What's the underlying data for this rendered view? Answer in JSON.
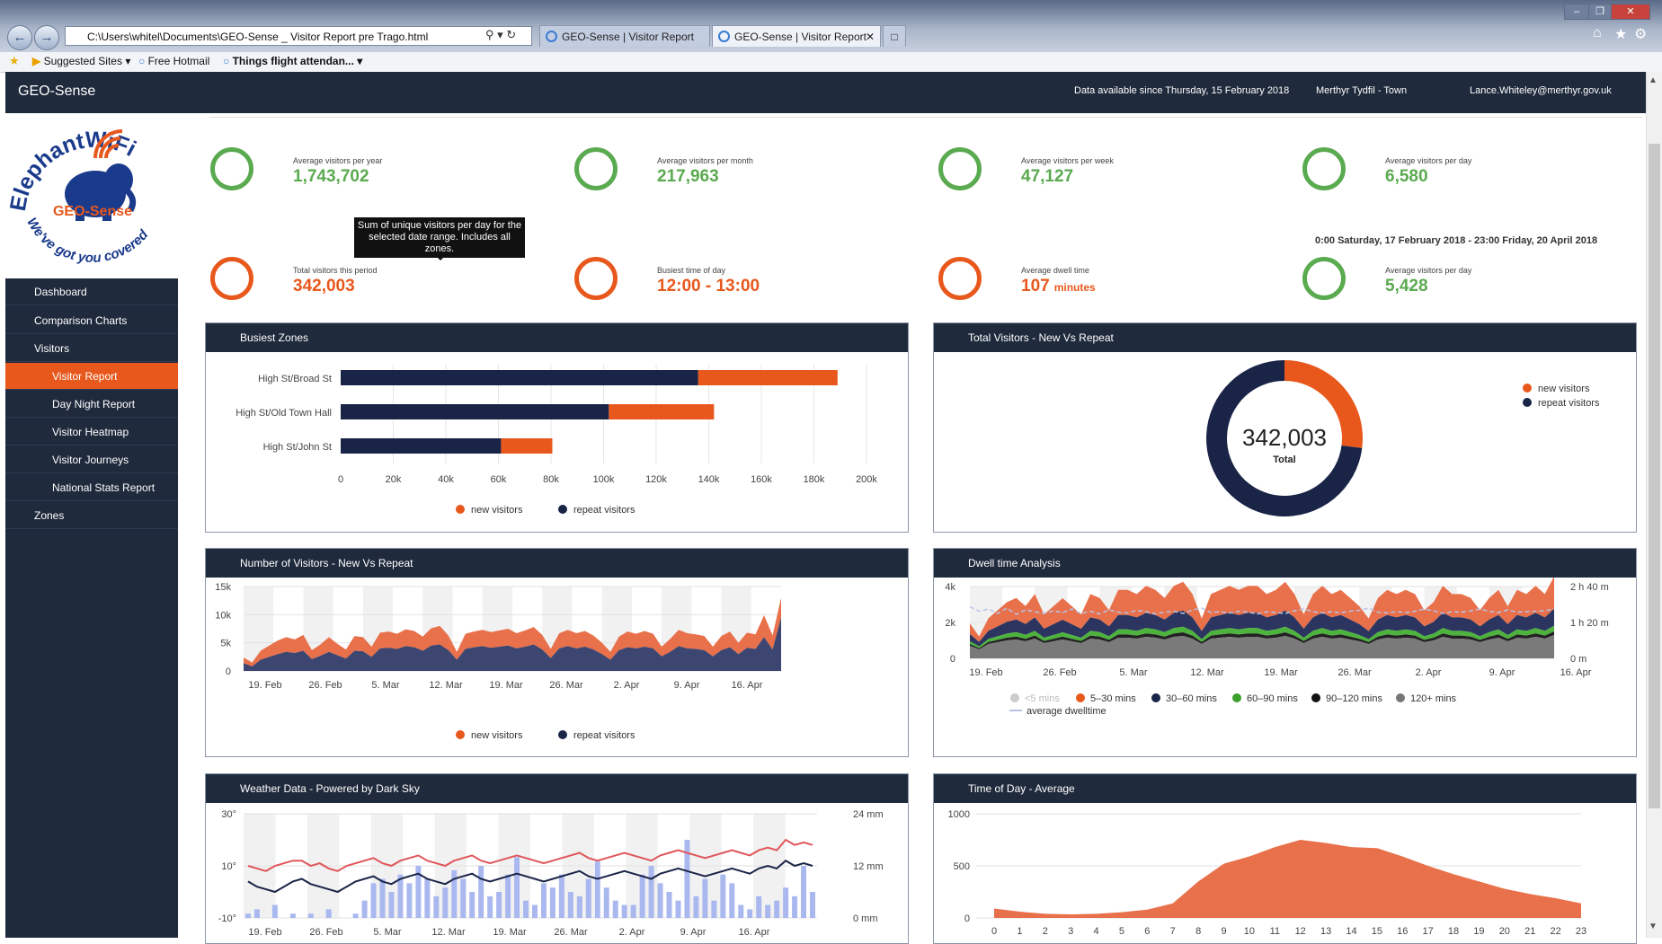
{
  "browser": {
    "address": "C:\\Users\\whitel\\Documents\\GEO-Sense _ Visitor Report pre Trago.html",
    "tabs": [
      "GEO-Sense | Visitor Report",
      "GEO-Sense | Visitor Report"
    ],
    "favorites": [
      "Suggested Sites",
      "Free Hotmail",
      "Things flight attendan..."
    ]
  },
  "header": {
    "app_title": "GEO-Sense",
    "data_since": "Data available since Thursday, 15 February 2018",
    "location": "Merthyr Tydfil - Town",
    "user": "Lance.Whiteley@merthyr.gov.uk"
  },
  "logo": {
    "brand": "ElephantWiFi",
    "product": "GEO-Sense",
    "tagline": "We've got you covered"
  },
  "sidebar": {
    "items": [
      {
        "label": "Dashboard",
        "level": 0
      },
      {
        "label": "Comparison Charts",
        "level": 0
      },
      {
        "label": "Visitors",
        "level": 0
      },
      {
        "label": "Visitor Report",
        "level": 1,
        "active": true
      },
      {
        "label": "Day Night Report",
        "level": 1
      },
      {
        "label": "Visitor Heatmap",
        "level": 1
      },
      {
        "label": "Visitor Journeys",
        "level": 1
      },
      {
        "label": "National Stats Report",
        "level": 1
      },
      {
        "label": "Zones",
        "level": 0
      }
    ]
  },
  "kpis_top": [
    {
      "label": "Average visitors per year",
      "value": "1,743,702"
    },
    {
      "label": "Average visitors per month",
      "value": "217,963"
    },
    {
      "label": "Average visitors per week",
      "value": "47,127"
    },
    {
      "label": "Average visitors per day",
      "value": "6,580"
    }
  ],
  "date_range": "0:00 Saturday, 17 February 2018 - 23:00 Friday, 20 April 2018",
  "tooltip": "Sum of unique visitors per day for the selected date range. Includes all zones.",
  "kpis_bottom": [
    {
      "label": "Total visitors this period",
      "value": "342,003",
      "unit": ""
    },
    {
      "label": "Busiest time of day",
      "value": "12:00 - 13:00",
      "unit": ""
    },
    {
      "label": "Average dwell time",
      "value": "107",
      "unit": "minutes"
    },
    {
      "label": "Average visitors per day",
      "value": "5,428",
      "unit": ""
    }
  ],
  "colors": {
    "new": "#e8581c",
    "repeat": "#1a2447",
    "green": "#5aaa4f",
    "navy": "#1f2a3c"
  },
  "panels": {
    "busiest_zones": "Busiest Zones",
    "new_vs_repeat": "Total Visitors - New Vs Repeat",
    "visitors_series": "Number of Visitors - New Vs Repeat",
    "dwell": "Dwell time Analysis",
    "weather": "Weather Data - Powered by Dark Sky",
    "time_of_day": "Time of Day - Average"
  },
  "chart_data": [
    {
      "type": "bar",
      "stacked": true,
      "orientation": "horizontal",
      "categories": [
        "High St/Broad St",
        "High St/Old Town Hall",
        "High St/John St"
      ],
      "series": [
        {
          "name": "repeat visitors",
          "values": [
            136000,
            102000,
            61000
          ]
        },
        {
          "name": "new visitors",
          "values": [
            53000,
            40000,
            19500
          ]
        }
      ],
      "xlim": [
        0,
        200000
      ],
      "xticks": [
        "0",
        "20k",
        "40k",
        "60k",
        "80k",
        "100k",
        "120k",
        "140k",
        "160k",
        "180k",
        "200k"
      ],
      "legend": "bottom"
    },
    {
      "type": "pie",
      "donut": true,
      "center_value": "342,003",
      "center_label": "Total",
      "series": [
        {
          "name": "new visitors",
          "value": 27
        },
        {
          "name": "repeat visitors",
          "value": 73
        }
      ],
      "legend": "top-right"
    },
    {
      "type": "area",
      "stacked": true,
      "x": [
        "19. Feb",
        "26. Feb",
        "5. Mar",
        "12. Mar",
        "19. Mar",
        "26. Mar",
        "2. Apr",
        "9. Apr",
        "16. Apr"
      ],
      "ylim": [
        0,
        15000
      ],
      "yticks": [
        "0",
        "5k",
        "10k",
        "15k"
      ],
      "series": [
        {
          "name": "repeat visitors",
          "values": [
            1400,
            800,
            2000,
            2500,
            3000,
            3400,
            3200,
            3600,
            2100,
            2700,
            3400,
            2800,
            2200,
            3600,
            3500,
            2500,
            4000,
            4100,
            3900,
            4400,
            4200,
            3600,
            4500,
            4700,
            3700,
            2000,
            3900,
            4200,
            4400,
            4100,
            4300,
            4500,
            4000,
            4300,
            4700,
            3800,
            2300,
            4000,
            4400,
            4000,
            4300,
            3800,
            3000,
            2000,
            3700,
            4200,
            4000,
            4300,
            4000,
            2600,
            3400,
            4400,
            4000,
            3900,
            3700,
            2600,
            3700,
            4200,
            3000,
            4100,
            3900,
            6000,
            3800,
            9500
          ]
        },
        {
          "name": "new visitors",
          "values": [
            1000,
            700,
            1600,
            2000,
            2400,
            2600,
            2400,
            2800,
            1600,
            2000,
            2600,
            2000,
            1600,
            2600,
            2500,
            1800,
            2800,
            2900,
            2700,
            3000,
            2900,
            2500,
            3100,
            3300,
            2600,
            1400,
            2700,
            2800,
            2900,
            2800,
            2900,
            3000,
            2700,
            2900,
            3100,
            2600,
            1600,
            2700,
            2900,
            2700,
            2800,
            2500,
            2000,
            1400,
            2400,
            2800,
            2600,
            2800,
            2600,
            1700,
            2300,
            2900,
            2700,
            2600,
            2500,
            1700,
            2500,
            2800,
            2000,
            2700,
            2600,
            3900,
            2500,
            3500
          ]
        }
      ],
      "legend": "bottom"
    },
    {
      "type": "area",
      "stacked": true,
      "x": [
        "19. Feb",
        "26. Feb",
        "5. Mar",
        "12. Mar",
        "19. Mar",
        "26. Mar",
        "2. Apr",
        "9. Apr",
        "16. Apr"
      ],
      "ylim": [
        0,
        4000
      ],
      "yticks": [
        "0",
        "2k",
        "4k"
      ],
      "y2ticks": [
        "0 m",
        "1 h 20 m",
        "2 h 40 m"
      ],
      "series": [
        {
          "name": "<5 mins",
          "values": []
        },
        {
          "name": "5–30 mins",
          "values": [
            600,
            300,
            700,
            900,
            1100,
            1200,
            1000,
            1300,
            800,
            1000,
            1200,
            1000,
            800,
            1300,
            1200,
            900,
            1400,
            1400,
            1300,
            1500,
            1400,
            1200,
            1500,
            1600,
            1300,
            700,
            1300,
            1400,
            1500,
            1400,
            1500,
            1500,
            1300,
            1400,
            1600,
            1300,
            800,
            1300,
            1500,
            1300,
            1400,
            1200,
            1000,
            700,
            1200,
            1400,
            1300,
            1400,
            1300,
            900,
            1100,
            1500,
            1300,
            1300,
            1200,
            900,
            1200,
            1400,
            1000,
            1400,
            1300,
            1500,
            1300,
            1800
          ]
        },
        {
          "name": "30–60 mins",
          "values": [
            400,
            250,
            450,
            550,
            650,
            700,
            600,
            750,
            500,
            600,
            700,
            600,
            500,
            750,
            700,
            550,
            800,
            800,
            750,
            850,
            800,
            700,
            850,
            900,
            750,
            450,
            750,
            800,
            850,
            800,
            850,
            850,
            750,
            800,
            900,
            750,
            500,
            750,
            850,
            750,
            800,
            700,
            600,
            450,
            700,
            800,
            750,
            800,
            750,
            550,
            650,
            850,
            750,
            750,
            700,
            550,
            700,
            800,
            600,
            800,
            750,
            850,
            750,
            950
          ]
        },
        {
          "name": "60–90 mins",
          "values": [
            150,
            100,
            170,
            200,
            230,
            250,
            220,
            260,
            180,
            210,
            240,
            210,
            180,
            260,
            250,
            200,
            280,
            280,
            260,
            300,
            280,
            250,
            300,
            310,
            260,
            160,
            260,
            280,
            300,
            280,
            300,
            300,
            260,
            280,
            310,
            260,
            180,
            260,
            300,
            260,
            280,
            250,
            210,
            160,
            250,
            280,
            260,
            280,
            260,
            200,
            230,
            300,
            260,
            260,
            250,
            200,
            250,
            280,
            210,
            280,
            260,
            300,
            260,
            320
          ]
        },
        {
          "name": "90–120 mins",
          "values": [
            100,
            70,
            110,
            130,
            150,
            160,
            140,
            170,
            120,
            140,
            160,
            140,
            120,
            170,
            160,
            130,
            180,
            180,
            170,
            190,
            180,
            160,
            190,
            200,
            170,
            110,
            170,
            180,
            190,
            180,
            190,
            190,
            170,
            180,
            200,
            170,
            120,
            170,
            190,
            170,
            180,
            160,
            140,
            110,
            160,
            180,
            170,
            180,
            170,
            130,
            150,
            190,
            170,
            170,
            160,
            130,
            160,
            180,
            140,
            180,
            170,
            190,
            170,
            200
          ]
        },
        {
          "name": "120+ mins",
          "values": [
            700,
            500,
            800,
            900,
            1000,
            1050,
            950,
            1100,
            850,
            950,
            1050,
            950,
            850,
            1100,
            1050,
            900,
            1150,
            1150,
            1100,
            1200,
            1150,
            1050,
            1200,
            1250,
            1100,
            800,
            1100,
            1150,
            1200,
            1150,
            1200,
            1200,
            1100,
            1150,
            1250,
            1100,
            850,
            1100,
            1200,
            1100,
            1150,
            1050,
            950,
            800,
            1050,
            1150,
            1100,
            1150,
            1100,
            900,
            1000,
            1200,
            1100,
            1100,
            1050,
            900,
            1050,
            1150,
            950,
            1150,
            1100,
            1200,
            1100,
            1300
          ]
        },
        {
          "name": "average dwelltime",
          "axis": "right",
          "values": [
            115,
            105,
            110,
            100,
            112,
            98,
            108,
            104,
            100,
            106,
            102,
            110,
            100,
            105,
            99,
            108,
            103,
            101,
            107,
            104,
            99,
            103,
            105,
            100,
            108,
            112,
            102,
            104,
            101,
            105,
            103,
            99,
            104,
            102,
            100,
            106,
            110,
            104,
            101,
            104,
            102,
            105,
            107,
            112,
            103,
            101,
            104,
            102,
            105,
            110,
            106,
            100,
            104,
            103,
            106,
            110,
            105,
            102,
            108,
            103,
            104,
            105,
            106,
            110
          ]
        }
      ],
      "legend": "bottom"
    },
    {
      "type": "line",
      "x": [
        "19. Feb",
        "26. Feb",
        "5. Mar",
        "12. Mar",
        "19. Mar",
        "26. Mar",
        "2. Apr",
        "9. Apr",
        "16. Apr"
      ],
      "yticks": [
        "-10°",
        "10°",
        "30°"
      ],
      "y2ticks": [
        "0 mm",
        "12 mm",
        "24 mm"
      ],
      "series": [
        {
          "name": "temperature high",
          "values": [
            10,
            9,
            8,
            10,
            11,
            12,
            12,
            10,
            11,
            9,
            8,
            10,
            11,
            12,
            13,
            11,
            10,
            12,
            13,
            14,
            12,
            11,
            10,
            12,
            13,
            14,
            12,
            11,
            12,
            13,
            14,
            13,
            12,
            11,
            12,
            13,
            14,
            15,
            13,
            12,
            13,
            14,
            15,
            14,
            13,
            12,
            14,
            15,
            16,
            15,
            14,
            13,
            14,
            15,
            16,
            15,
            14,
            16,
            17,
            16,
            20,
            18,
            19,
            18
          ]
        },
        {
          "name": "temperature low",
          "values": [
            4,
            2,
            1,
            0,
            2,
            4,
            5,
            3,
            2,
            1,
            0,
            2,
            4,
            5,
            6,
            4,
            3,
            5,
            6,
            7,
            5,
            4,
            3,
            5,
            6,
            7,
            5,
            4,
            5,
            6,
            7,
            6,
            5,
            4,
            5,
            6,
            7,
            8,
            6,
            5,
            6,
            7,
            8,
            7,
            6,
            5,
            7,
            8,
            9,
            8,
            7,
            6,
            7,
            8,
            9,
            8,
            7,
            9,
            10,
            9,
            12,
            10,
            11,
            10
          ]
        },
        {
          "name": "precipitation",
          "axis": "right",
          "values": [
            1,
            2,
            0,
            3,
            0,
            1,
            0,
            1,
            0,
            2,
            0,
            0,
            1,
            4,
            8,
            9,
            6,
            10,
            8,
            12,
            9,
            5,
            7,
            11,
            9,
            6,
            12,
            5,
            6,
            10,
            14,
            4,
            3,
            8,
            7,
            10,
            6,
            5,
            9,
            13,
            7,
            4,
            3,
            3,
            10,
            12,
            8,
            6,
            4,
            18,
            5,
            9,
            4,
            10,
            8,
            3,
            2,
            5,
            3,
            4,
            7,
            5,
            12,
            6
          ]
        }
      ]
    },
    {
      "type": "area",
      "categories": [
        "0",
        "1",
        "2",
        "3",
        "4",
        "5",
        "6",
        "7",
        "8",
        "9",
        "10",
        "11",
        "12",
        "13",
        "14",
        "15",
        "16",
        "17",
        "18",
        "19",
        "20",
        "21",
        "22",
        "23"
      ],
      "values": [
        90,
        60,
        40,
        35,
        40,
        55,
        80,
        140,
        350,
        520,
        590,
        680,
        750,
        720,
        680,
        670,
        590,
        500,
        420,
        350,
        280,
        230,
        190,
        140
      ],
      "ylim": [
        0,
        1000
      ],
      "yticks": [
        "0",
        "500",
        "1000"
      ]
    }
  ]
}
